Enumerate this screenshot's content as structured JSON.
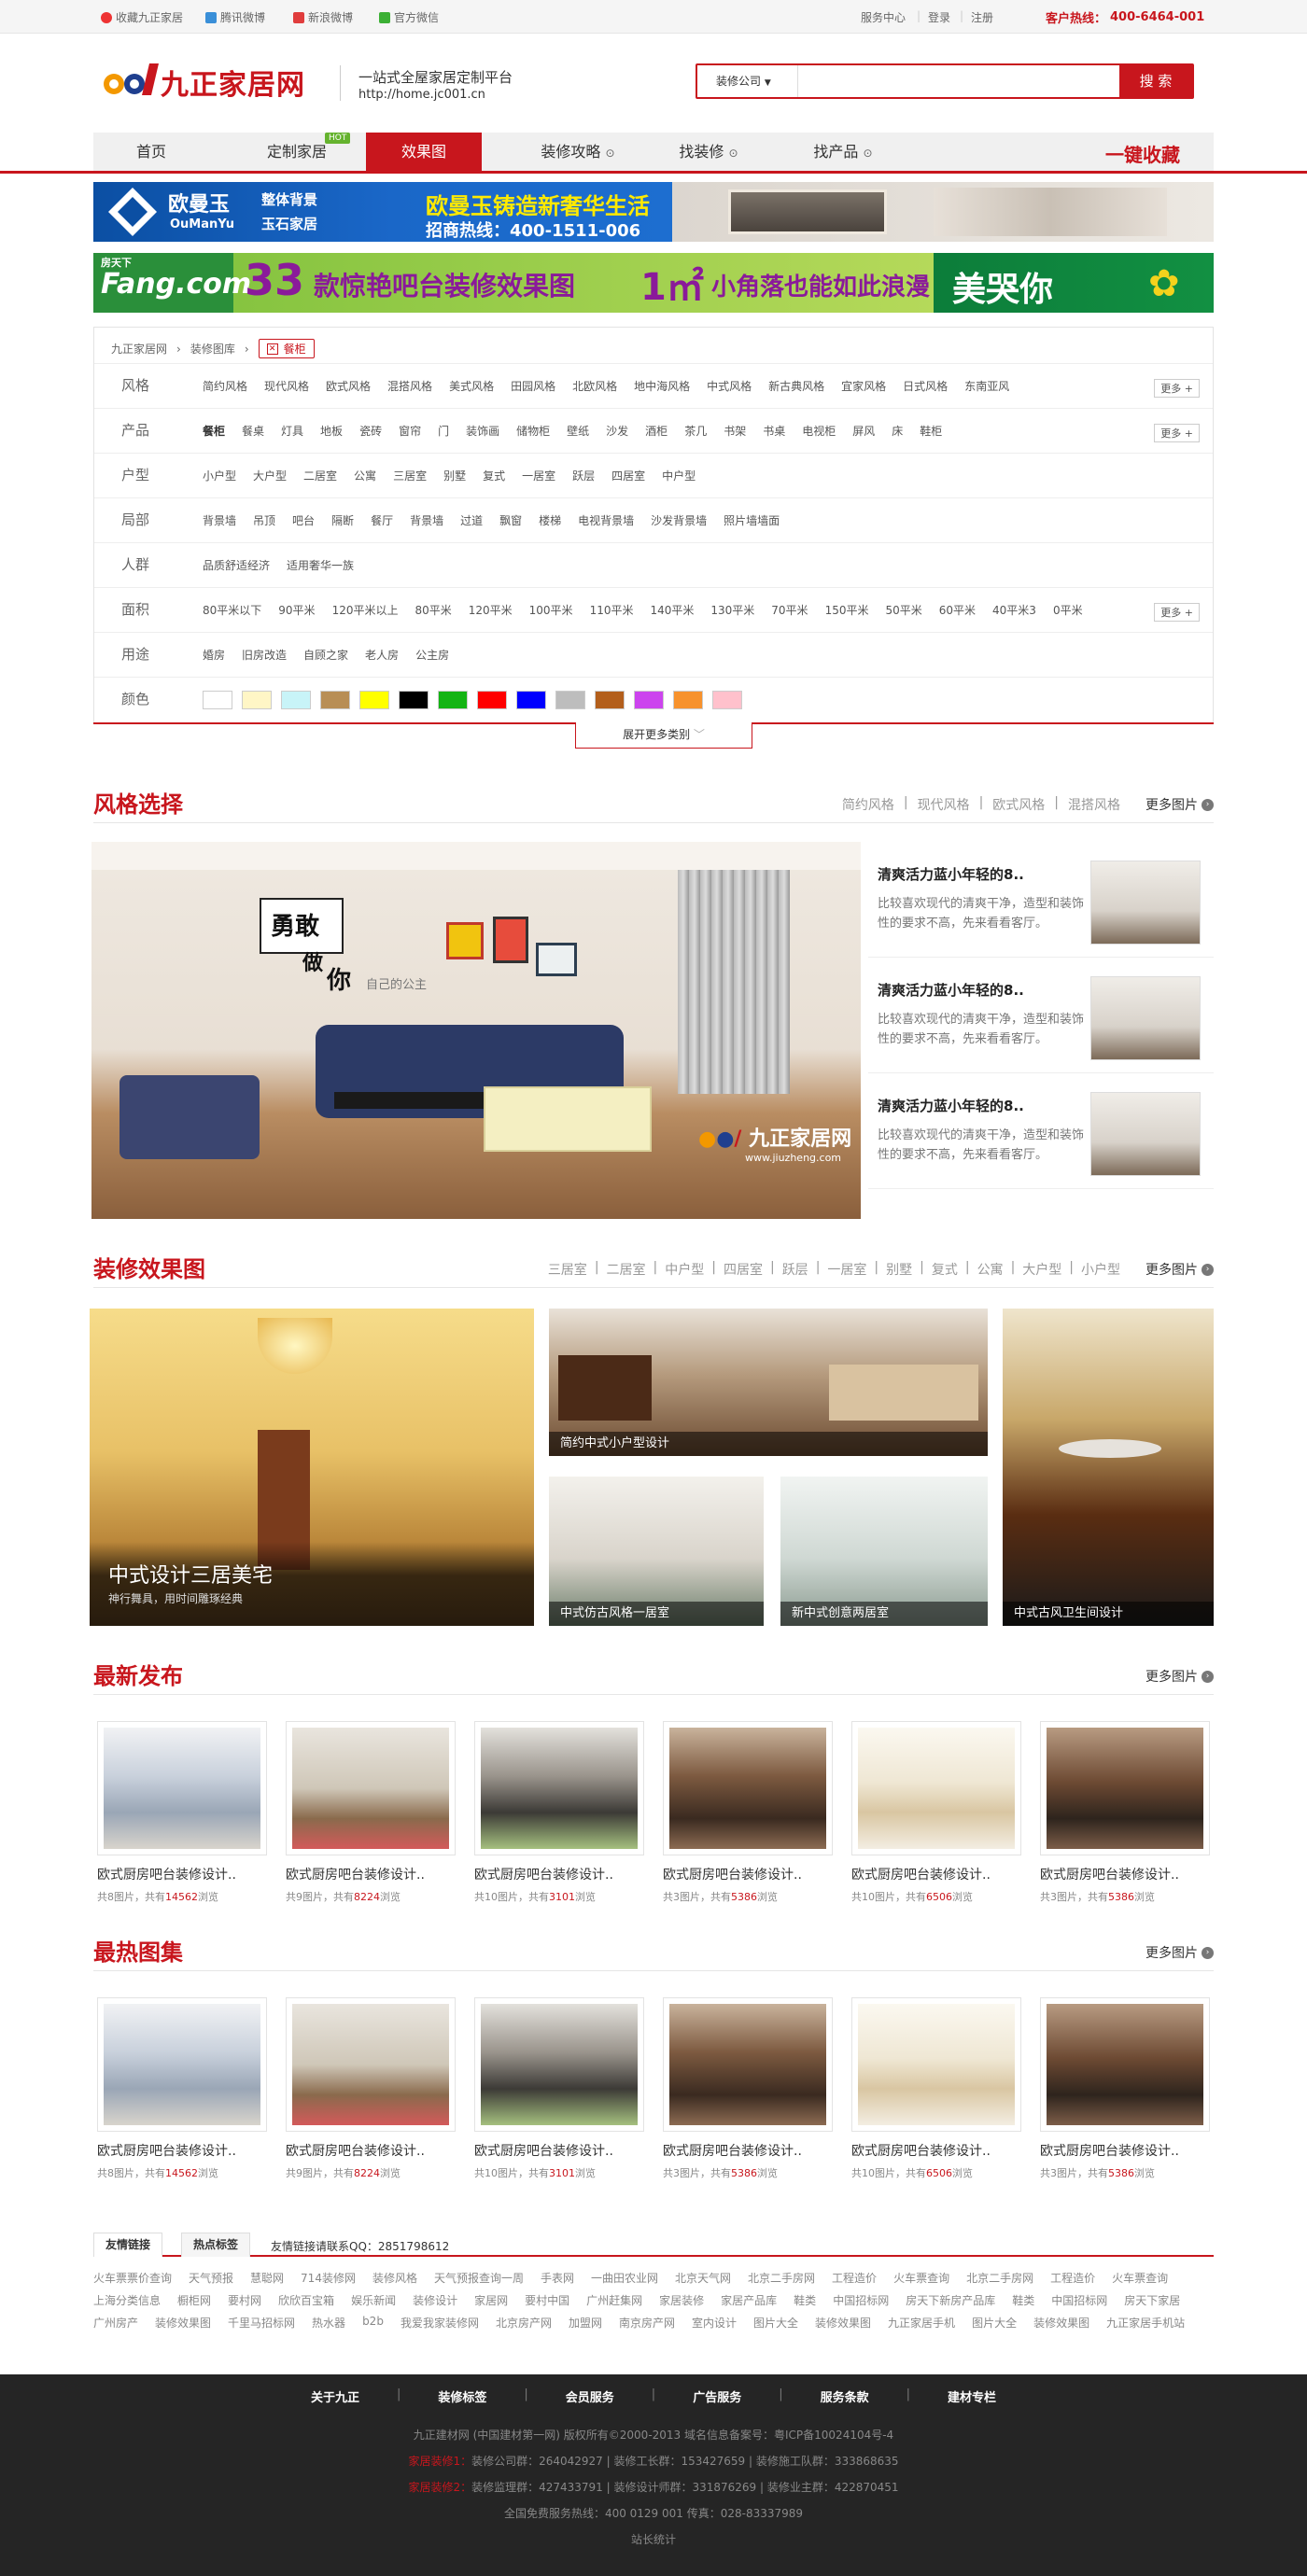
{
  "topbar": {
    "collect": "收藏九正家居",
    "tencent": "腾讯微博",
    "sina": "新浪微博",
    "wechat": "官方微信",
    "service": "服务中心",
    "login": "登录",
    "register": "注册",
    "hotline_label": "客户热线：",
    "hotline": "400-6464-001"
  },
  "header": {
    "logo_text": "九正家居网",
    "slogan": "一站式全屋家居定制平台",
    "url": "http://home.jc001.cn",
    "search_select": "装修公司",
    "search_placeholder": "",
    "search_button": "搜 索"
  },
  "nav": {
    "items": [
      "首页",
      "定制家居",
      "效果图",
      "装修攻略",
      "找装修",
      "找产品"
    ],
    "hot_badge": "HOT",
    "collect": "一键收藏",
    "colors": {
      "accent": "#c8161d",
      "hot": "#65b32e"
    }
  },
  "banners": {
    "b1_brand": "欧曼玉",
    "b1_brand_en": "OuManYu",
    "b1_sub1": "整体背景",
    "b1_sub2": "玉石家居",
    "b1_title": "欧曼玉铸造新奢华生活",
    "b1_hotline": "招商热线：400-1511-006",
    "b2_logo": "Fang.com",
    "b2_logo_sub": "房天下",
    "b2_num": "33",
    "b2_text1": "款惊艳吧台装修效果图",
    "b2_num2": "1㎡",
    "b2_text2": "小角落也能如此浪漫",
    "b2_right": "美哭你"
  },
  "filter": {
    "crumb": [
      "九正家居网",
      "装修图库"
    ],
    "selected_tag": "餐柜",
    "more": "更多",
    "expand": "展开更多类别",
    "rows": [
      {
        "label": "风格",
        "options": [
          "简约风格",
          "现代风格",
          "欧式风格",
          "混搭风格",
          "美式风格",
          "田园风格",
          "北欧风格",
          "地中海风格",
          "中式风格",
          "新古典风格",
          "宜家风格",
          "日式风格",
          "东南亚风"
        ]
      },
      {
        "label": "产品",
        "options": [
          "餐柜",
          "餐桌",
          "灯具",
          "地板",
          "瓷砖",
          "窗帘",
          "门",
          "装饰画",
          "储物柜",
          "壁纸",
          "沙发",
          "酒柜",
          "茶几",
          "书架",
          "书桌",
          "电视柜",
          "屏风",
          "床",
          "鞋柜"
        ]
      },
      {
        "label": "户型",
        "options": [
          "小户型",
          "大户型",
          "二居室",
          "公寓",
          "三居室",
          "别墅",
          "复式",
          "一居室",
          "跃层",
          "四居室",
          "中户型"
        ]
      },
      {
        "label": "局部",
        "options": [
          "背景墙",
          "吊顶",
          "吧台",
          "隔断",
          "餐厅",
          "背景墙",
          "过道",
          "飘窗",
          "楼梯",
          "电视背景墙",
          "沙发背景墙",
          "照片墙墙面"
        ]
      },
      {
        "label": "人群",
        "options": [
          "品质舒适经济",
          "适用奢华一族"
        ]
      },
      {
        "label": "面积",
        "options": [
          "80平米以下",
          "90平米",
          "120平米以上",
          "80平米",
          "120平米",
          "100平米",
          "110平米",
          "140平米",
          "130平米",
          "70平米",
          "150平米",
          "50平米",
          "60平米",
          "40平米3",
          "0平米"
        ]
      },
      {
        "label": "用途",
        "options": [
          "婚房",
          "旧房改造",
          "自顾之家",
          "老人房",
          "公主房"
        ]
      },
      {
        "label": "颜色",
        "swatches": [
          "#ffffff",
          "#fff6c6",
          "#c8f4f8",
          "#b88e55",
          "#ffff00",
          "#000000",
          "#13b413",
          "#ff0000",
          "#0000ff",
          "#bdbdbd",
          "#b35f1c",
          "#cc44ee",
          "#f7922d",
          "#ffc1cc"
        ]
      }
    ]
  },
  "style_section": {
    "title": "风格选择",
    "cats": [
      "简约风格",
      "现代风格",
      "欧式风格",
      "混搭风格"
    ],
    "more": "更多图片",
    "hero_text1": "勇敢",
    "hero_text2": "做",
    "hero_text3": "你",
    "hero_text4": "自己的公主",
    "watermark": "九正家居网",
    "watermark_url": "www.jiuzheng.com",
    "items": [
      {
        "title": "清爽活力蓝小年轻的8..",
        "desc": "比较喜欢现代的清爽干净，造型和装饰性的要求不高，先来看看客厅。"
      },
      {
        "title": "清爽活力蓝小年轻的8..",
        "desc": "比较喜欢现代的清爽干净，造型和装饰性的要求不高，先来看看客厅。"
      },
      {
        "title": "清爽活力蓝小年轻的8..",
        "desc": "比较喜欢现代的清爽干净，造型和装饰性的要求不高，先来看看客厅。"
      }
    ]
  },
  "effect_section": {
    "title": "装修效果图",
    "cats": [
      "三居室",
      "二居室",
      "中户型",
      "四居室",
      "跃层",
      "一居室",
      "别墅",
      "复式",
      "公寓",
      "大户型",
      "小户型"
    ],
    "more": "更多图片",
    "big_title": "中式设计三居美宅",
    "big_sub": "神行舞具，用时间雕琢经典",
    "caps": [
      "简约中式小户型设计",
      "中式仿古风格一居室",
      "新中式创意两居室",
      "中式古风卫生间设计"
    ]
  },
  "latest": {
    "title": "最新发布",
    "more": "更多图片",
    "cards": [
      {
        "title": "欧式厨房吧台装修设计..",
        "imgs": "8",
        "views": "14562"
      },
      {
        "title": "欧式厨房吧台装修设计..",
        "imgs": "9",
        "views": "8224"
      },
      {
        "title": "欧式厨房吧台装修设计..",
        "imgs": "10",
        "views": "3101"
      },
      {
        "title": "欧式厨房吧台装修设计..",
        "imgs": "3",
        "views": "5386"
      },
      {
        "title": "欧式厨房吧台装修设计..",
        "imgs": "10",
        "views": "6506"
      },
      {
        "title": "欧式厨房吧台装修设计..",
        "imgs": "3",
        "views": "5386"
      }
    ]
  },
  "hottest": {
    "title": "最热图集",
    "more": "更多图片",
    "cards": [
      {
        "title": "欧式厨房吧台装修设计..",
        "imgs": "8",
        "views": "14562"
      },
      {
        "title": "欧式厨房吧台装修设计..",
        "imgs": "9",
        "views": "8224"
      },
      {
        "title": "欧式厨房吧台装修设计..",
        "imgs": "10",
        "views": "3101"
      },
      {
        "title": "欧式厨房吧台装修设计..",
        "imgs": "3",
        "views": "5386"
      },
      {
        "title": "欧式厨房吧台装修设计..",
        "imgs": "10",
        "views": "6506"
      },
      {
        "title": "欧式厨房吧台装修设计..",
        "imgs": "3",
        "views": "5386"
      }
    ]
  },
  "card_labels": {
    "total": "共",
    "imgs_unit": "图片，",
    "views_pre": "共有",
    "views_unit": "浏览"
  },
  "links": {
    "tab1": "友情链接",
    "tab2": "热点标签",
    "contact": "友情链接请联系QQ：2851798612",
    "row1": [
      "火车票票价查询",
      "天气预报",
      "慧聪网",
      "714装修网",
      "装修风格",
      "天气预报查询一周",
      "手表网",
      "一曲田农业网",
      "北京天气网",
      "北京二手房网",
      "工程造价",
      "火车票查询",
      "北京二手房网",
      "工程造价",
      "火车票查询"
    ],
    "row2": [
      "上海分类信息",
      "橱柜网",
      "要村网",
      "欣欣百宝箱",
      "娱乐新闻",
      "装修设计",
      "家居网",
      "要村中国",
      "广州赶集网",
      "家居装修",
      "家居产品库",
      "鞋类",
      "中国招标网",
      "房天下新房产品库",
      "鞋类",
      "中国招标网",
      "房天下家居"
    ],
    "row3": [
      "广州房产",
      "装修效果图",
      "千里马招标网",
      "热水器",
      "b2b",
      "我爱我家装修网",
      "北京房产网",
      "加盟网",
      "南京房产网",
      "室内设计",
      "图片大全",
      "装修效果图",
      "九正家居手机",
      "图片大全",
      "装修效果图",
      "九正家居手机站"
    ]
  },
  "footer": {
    "nav": [
      "关于九正",
      "装修标签",
      "会员服务",
      "广告服务",
      "服务条款",
      "建材专栏"
    ],
    "copyright": "九正建材网 (中国建材第一网) 版权所有©2000-2013   域名信息备案号：粤ICP备10024104号-4",
    "line1_label": "家居装修1：",
    "line1": "装修公司群：264042927 | 装修工长群：153427659 | 装修施工队群：333868635",
    "line2_label": "家居装修2：",
    "line2": "装修监理群：427433791 | 装修设计师群：331876269 | 装修业主群：422870451",
    "line3": "全国免费服务热线：400 0129 001   传真：028-83337989",
    "line4": "站长统计"
  }
}
